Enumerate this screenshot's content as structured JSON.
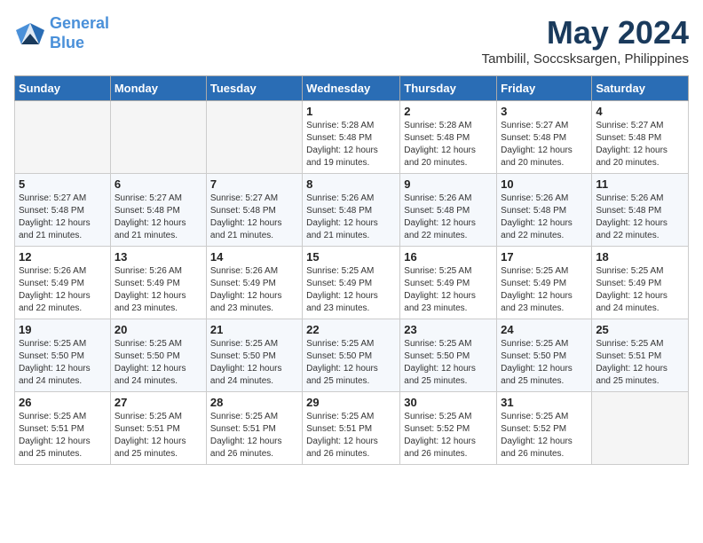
{
  "header": {
    "logo_line1": "General",
    "logo_line2": "Blue",
    "month_title": "May 2024",
    "location": "Tambilil, Soccsksargen, Philippines"
  },
  "weekdays": [
    "Sunday",
    "Monday",
    "Tuesday",
    "Wednesday",
    "Thursday",
    "Friday",
    "Saturday"
  ],
  "weeks": [
    [
      {
        "num": "",
        "info": ""
      },
      {
        "num": "",
        "info": ""
      },
      {
        "num": "",
        "info": ""
      },
      {
        "num": "1",
        "info": "Sunrise: 5:28 AM\nSunset: 5:48 PM\nDaylight: 12 hours\nand 19 minutes."
      },
      {
        "num": "2",
        "info": "Sunrise: 5:28 AM\nSunset: 5:48 PM\nDaylight: 12 hours\nand 20 minutes."
      },
      {
        "num": "3",
        "info": "Sunrise: 5:27 AM\nSunset: 5:48 PM\nDaylight: 12 hours\nand 20 minutes."
      },
      {
        "num": "4",
        "info": "Sunrise: 5:27 AM\nSunset: 5:48 PM\nDaylight: 12 hours\nand 20 minutes."
      }
    ],
    [
      {
        "num": "5",
        "info": "Sunrise: 5:27 AM\nSunset: 5:48 PM\nDaylight: 12 hours\nand 21 minutes."
      },
      {
        "num": "6",
        "info": "Sunrise: 5:27 AM\nSunset: 5:48 PM\nDaylight: 12 hours\nand 21 minutes."
      },
      {
        "num": "7",
        "info": "Sunrise: 5:27 AM\nSunset: 5:48 PM\nDaylight: 12 hours\nand 21 minutes."
      },
      {
        "num": "8",
        "info": "Sunrise: 5:26 AM\nSunset: 5:48 PM\nDaylight: 12 hours\nand 21 minutes."
      },
      {
        "num": "9",
        "info": "Sunrise: 5:26 AM\nSunset: 5:48 PM\nDaylight: 12 hours\nand 22 minutes."
      },
      {
        "num": "10",
        "info": "Sunrise: 5:26 AM\nSunset: 5:48 PM\nDaylight: 12 hours\nand 22 minutes."
      },
      {
        "num": "11",
        "info": "Sunrise: 5:26 AM\nSunset: 5:48 PM\nDaylight: 12 hours\nand 22 minutes."
      }
    ],
    [
      {
        "num": "12",
        "info": "Sunrise: 5:26 AM\nSunset: 5:49 PM\nDaylight: 12 hours\nand 22 minutes."
      },
      {
        "num": "13",
        "info": "Sunrise: 5:26 AM\nSunset: 5:49 PM\nDaylight: 12 hours\nand 23 minutes."
      },
      {
        "num": "14",
        "info": "Sunrise: 5:26 AM\nSunset: 5:49 PM\nDaylight: 12 hours\nand 23 minutes."
      },
      {
        "num": "15",
        "info": "Sunrise: 5:25 AM\nSunset: 5:49 PM\nDaylight: 12 hours\nand 23 minutes."
      },
      {
        "num": "16",
        "info": "Sunrise: 5:25 AM\nSunset: 5:49 PM\nDaylight: 12 hours\nand 23 minutes."
      },
      {
        "num": "17",
        "info": "Sunrise: 5:25 AM\nSunset: 5:49 PM\nDaylight: 12 hours\nand 23 minutes."
      },
      {
        "num": "18",
        "info": "Sunrise: 5:25 AM\nSunset: 5:49 PM\nDaylight: 12 hours\nand 24 minutes."
      }
    ],
    [
      {
        "num": "19",
        "info": "Sunrise: 5:25 AM\nSunset: 5:50 PM\nDaylight: 12 hours\nand 24 minutes."
      },
      {
        "num": "20",
        "info": "Sunrise: 5:25 AM\nSunset: 5:50 PM\nDaylight: 12 hours\nand 24 minutes."
      },
      {
        "num": "21",
        "info": "Sunrise: 5:25 AM\nSunset: 5:50 PM\nDaylight: 12 hours\nand 24 minutes."
      },
      {
        "num": "22",
        "info": "Sunrise: 5:25 AM\nSunset: 5:50 PM\nDaylight: 12 hours\nand 25 minutes."
      },
      {
        "num": "23",
        "info": "Sunrise: 5:25 AM\nSunset: 5:50 PM\nDaylight: 12 hours\nand 25 minutes."
      },
      {
        "num": "24",
        "info": "Sunrise: 5:25 AM\nSunset: 5:50 PM\nDaylight: 12 hours\nand 25 minutes."
      },
      {
        "num": "25",
        "info": "Sunrise: 5:25 AM\nSunset: 5:51 PM\nDaylight: 12 hours\nand 25 minutes."
      }
    ],
    [
      {
        "num": "26",
        "info": "Sunrise: 5:25 AM\nSunset: 5:51 PM\nDaylight: 12 hours\nand 25 minutes."
      },
      {
        "num": "27",
        "info": "Sunrise: 5:25 AM\nSunset: 5:51 PM\nDaylight: 12 hours\nand 25 minutes."
      },
      {
        "num": "28",
        "info": "Sunrise: 5:25 AM\nSunset: 5:51 PM\nDaylight: 12 hours\nand 26 minutes."
      },
      {
        "num": "29",
        "info": "Sunrise: 5:25 AM\nSunset: 5:51 PM\nDaylight: 12 hours\nand 26 minutes."
      },
      {
        "num": "30",
        "info": "Sunrise: 5:25 AM\nSunset: 5:52 PM\nDaylight: 12 hours\nand 26 minutes."
      },
      {
        "num": "31",
        "info": "Sunrise: 5:25 AM\nSunset: 5:52 PM\nDaylight: 12 hours\nand 26 minutes."
      },
      {
        "num": "",
        "info": ""
      }
    ]
  ]
}
